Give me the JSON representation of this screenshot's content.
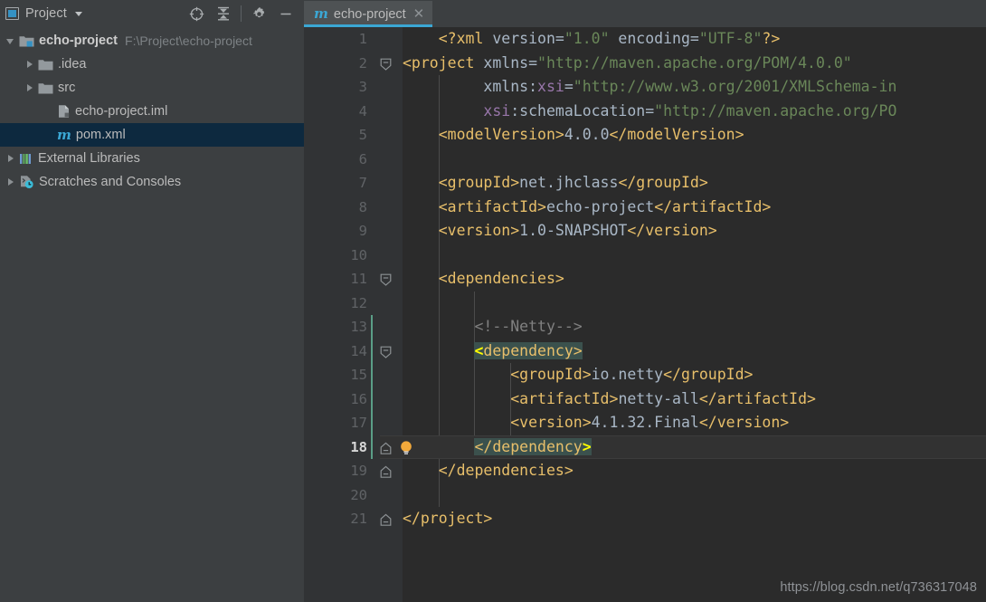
{
  "sidebar": {
    "title": "Project",
    "title_icon": "project-window-icon",
    "dropdown_icon": "chevron-down-icon",
    "toolbar": [
      {
        "name": "locate-in-tree-icon",
        "label": "Select Opened File"
      },
      {
        "name": "collapse-all-icon",
        "label": "Collapse All"
      },
      {
        "name": "gear-icon",
        "label": "Settings"
      },
      {
        "name": "minimize-icon",
        "label": "Hide"
      }
    ],
    "tree": [
      {
        "label": "echo-project",
        "path": "F:\\Project\\echo-project",
        "icon": "module-folder-icon",
        "twisty": "open",
        "indent": 0,
        "bold": true,
        "selected": false
      },
      {
        "label": ".idea",
        "path": "",
        "icon": "folder-icon",
        "twisty": "closed",
        "indent": 1,
        "bold": false,
        "selected": false
      },
      {
        "label": "src",
        "path": "",
        "icon": "folder-icon",
        "twisty": "closed",
        "indent": 1,
        "bold": false,
        "selected": false
      },
      {
        "label": "echo-project.iml",
        "path": "",
        "icon": "iml-file-icon",
        "twisty": "none",
        "indent": 2,
        "bold": false,
        "selected": false
      },
      {
        "label": "pom.xml",
        "path": "",
        "icon": "maven-file-icon",
        "twisty": "none",
        "indent": 2,
        "bold": false,
        "selected": true
      },
      {
        "label": "External Libraries",
        "path": "",
        "icon": "libraries-icon",
        "twisty": "closed",
        "indent": 0,
        "bold": false,
        "selected": false
      },
      {
        "label": "Scratches and Consoles",
        "path": "",
        "icon": "scratches-icon",
        "twisty": "closed",
        "indent": 0,
        "bold": false,
        "selected": false
      }
    ]
  },
  "editor": {
    "tabs": [
      {
        "label": "echo-project",
        "icon": "maven-file-icon",
        "close_icon": "close-icon",
        "active": true
      }
    ],
    "current_line": 18,
    "lines": [
      {
        "n": 1,
        "fold": "none",
        "tokens": [
          {
            "t": "    ",
            "c": "s-txt"
          },
          {
            "t": "<?xml",
            "c": "s-proc"
          },
          {
            "t": " version=",
            "c": "s-txt"
          },
          {
            "t": "\"1.0\"",
            "c": "s-str"
          },
          {
            "t": " encoding=",
            "c": "s-txt"
          },
          {
            "t": "\"UTF-8\"",
            "c": "s-str"
          },
          {
            "t": "?>",
            "c": "s-proc"
          }
        ]
      },
      {
        "n": 2,
        "fold": "open",
        "tokens": [
          {
            "t": "<project",
            "c": "s-tag"
          },
          {
            "t": " xmlns=",
            "c": "s-txt"
          },
          {
            "t": "\"http://maven.apache.org/POM/4.0.0\"",
            "c": "s-str"
          }
        ]
      },
      {
        "n": 3,
        "fold": "none",
        "tokens": [
          {
            "t": "         xmlns:",
            "c": "s-txt"
          },
          {
            "t": "xsi",
            "c": "s-attr"
          },
          {
            "t": "=",
            "c": "s-txt"
          },
          {
            "t": "\"http://www.w3.org/2001/XMLSchema-in",
            "c": "s-str"
          }
        ]
      },
      {
        "n": 4,
        "fold": "none",
        "tokens": [
          {
            "t": "         ",
            "c": "s-txt"
          },
          {
            "t": "xsi",
            "c": "s-attr"
          },
          {
            "t": ":schemaLocation=",
            "c": "s-txt"
          },
          {
            "t": "\"http://maven.apache.org/PO",
            "c": "s-str"
          }
        ]
      },
      {
        "n": 5,
        "fold": "none",
        "tokens": [
          {
            "t": "    ",
            "c": "s-txt"
          },
          {
            "t": "<modelVersion>",
            "c": "s-tag"
          },
          {
            "t": "4.0.0",
            "c": "s-txt"
          },
          {
            "t": "</modelVersion>",
            "c": "s-tag"
          }
        ]
      },
      {
        "n": 6,
        "fold": "none",
        "tokens": []
      },
      {
        "n": 7,
        "fold": "none",
        "tokens": [
          {
            "t": "    ",
            "c": "s-txt"
          },
          {
            "t": "<groupId>",
            "c": "s-tag"
          },
          {
            "t": "net.jhclass",
            "c": "s-txt"
          },
          {
            "t": "</groupId>",
            "c": "s-tag"
          }
        ]
      },
      {
        "n": 8,
        "fold": "none",
        "tokens": [
          {
            "t": "    ",
            "c": "s-txt"
          },
          {
            "t": "<artifactId>",
            "c": "s-tag"
          },
          {
            "t": "echo-project",
            "c": "s-txt"
          },
          {
            "t": "</artifactId>",
            "c": "s-tag"
          }
        ]
      },
      {
        "n": 9,
        "fold": "none",
        "tokens": [
          {
            "t": "    ",
            "c": "s-txt"
          },
          {
            "t": "<version>",
            "c": "s-tag"
          },
          {
            "t": "1.0-SNAPSHOT",
            "c": "s-txt"
          },
          {
            "t": "</version>",
            "c": "s-tag"
          }
        ]
      },
      {
        "n": 10,
        "fold": "none",
        "tokens": []
      },
      {
        "n": 11,
        "fold": "open",
        "tokens": [
          {
            "t": "    ",
            "c": "s-txt"
          },
          {
            "t": "<dependencies>",
            "c": "s-tag"
          }
        ]
      },
      {
        "n": 12,
        "fold": "none",
        "tokens": []
      },
      {
        "n": 13,
        "fold": "none",
        "tokens": [
          {
            "t": "        ",
            "c": "s-txt"
          },
          {
            "t": "<!--Netty-->",
            "c": "s-cmt"
          }
        ]
      },
      {
        "n": 14,
        "fold": "open",
        "tokens": [
          {
            "t": "        ",
            "c": "s-txt"
          },
          {
            "t": "<",
            "c": "s-caret s-match"
          },
          {
            "t": "dependency>",
            "c": "s-tag s-match"
          }
        ]
      },
      {
        "n": 15,
        "fold": "none",
        "tokens": [
          {
            "t": "            ",
            "c": "s-txt"
          },
          {
            "t": "<groupId>",
            "c": "s-tag"
          },
          {
            "t": "io.netty",
            "c": "s-txt"
          },
          {
            "t": "</groupId>",
            "c": "s-tag"
          }
        ]
      },
      {
        "n": 16,
        "fold": "none",
        "tokens": [
          {
            "t": "            ",
            "c": "s-txt"
          },
          {
            "t": "<artifactId>",
            "c": "s-tag"
          },
          {
            "t": "netty-all",
            "c": "s-txt"
          },
          {
            "t": "</artifactId>",
            "c": "s-tag"
          }
        ]
      },
      {
        "n": 17,
        "fold": "none",
        "tokens": [
          {
            "t": "            ",
            "c": "s-txt"
          },
          {
            "t": "<version>",
            "c": "s-tag"
          },
          {
            "t": "4.1.32.Final",
            "c": "s-txt"
          },
          {
            "t": "</version>",
            "c": "s-tag"
          }
        ]
      },
      {
        "n": 18,
        "fold": "close",
        "tokens": [
          {
            "t": "        ",
            "c": "s-txt"
          },
          {
            "t": "</dependency",
            "c": "s-tag s-match"
          },
          {
            "t": ">",
            "c": "s-caret s-match"
          }
        ]
      },
      {
        "n": 19,
        "fold": "close",
        "tokens": [
          {
            "t": "    ",
            "c": "s-txt"
          },
          {
            "t": "</dependencies>",
            "c": "s-tag"
          }
        ]
      },
      {
        "n": 20,
        "fold": "none",
        "tokens": []
      },
      {
        "n": 21,
        "fold": "close",
        "tokens": [
          {
            "t": "</project>",
            "c": "s-tag"
          }
        ]
      }
    ]
  },
  "watermark": "https://blog.csdn.net/q736317048",
  "colors": {
    "sidebar_bg": "#3c3f41",
    "editor_bg": "#2b2b2b",
    "gutter_bg": "#313335",
    "selection_bg": "#0d293f",
    "tab_active_bg": "#4e5254",
    "tab_underline": "#3ba7d4",
    "tag": "#e8bf6a",
    "string": "#6a8759",
    "text": "#a9b7c6",
    "attribute": "#9876aa",
    "comment": "#808080",
    "match_highlight": "#3b514d",
    "caret_token": "#ffff00",
    "change_marker": "#5a9e87",
    "accent": "#3592c4"
  }
}
